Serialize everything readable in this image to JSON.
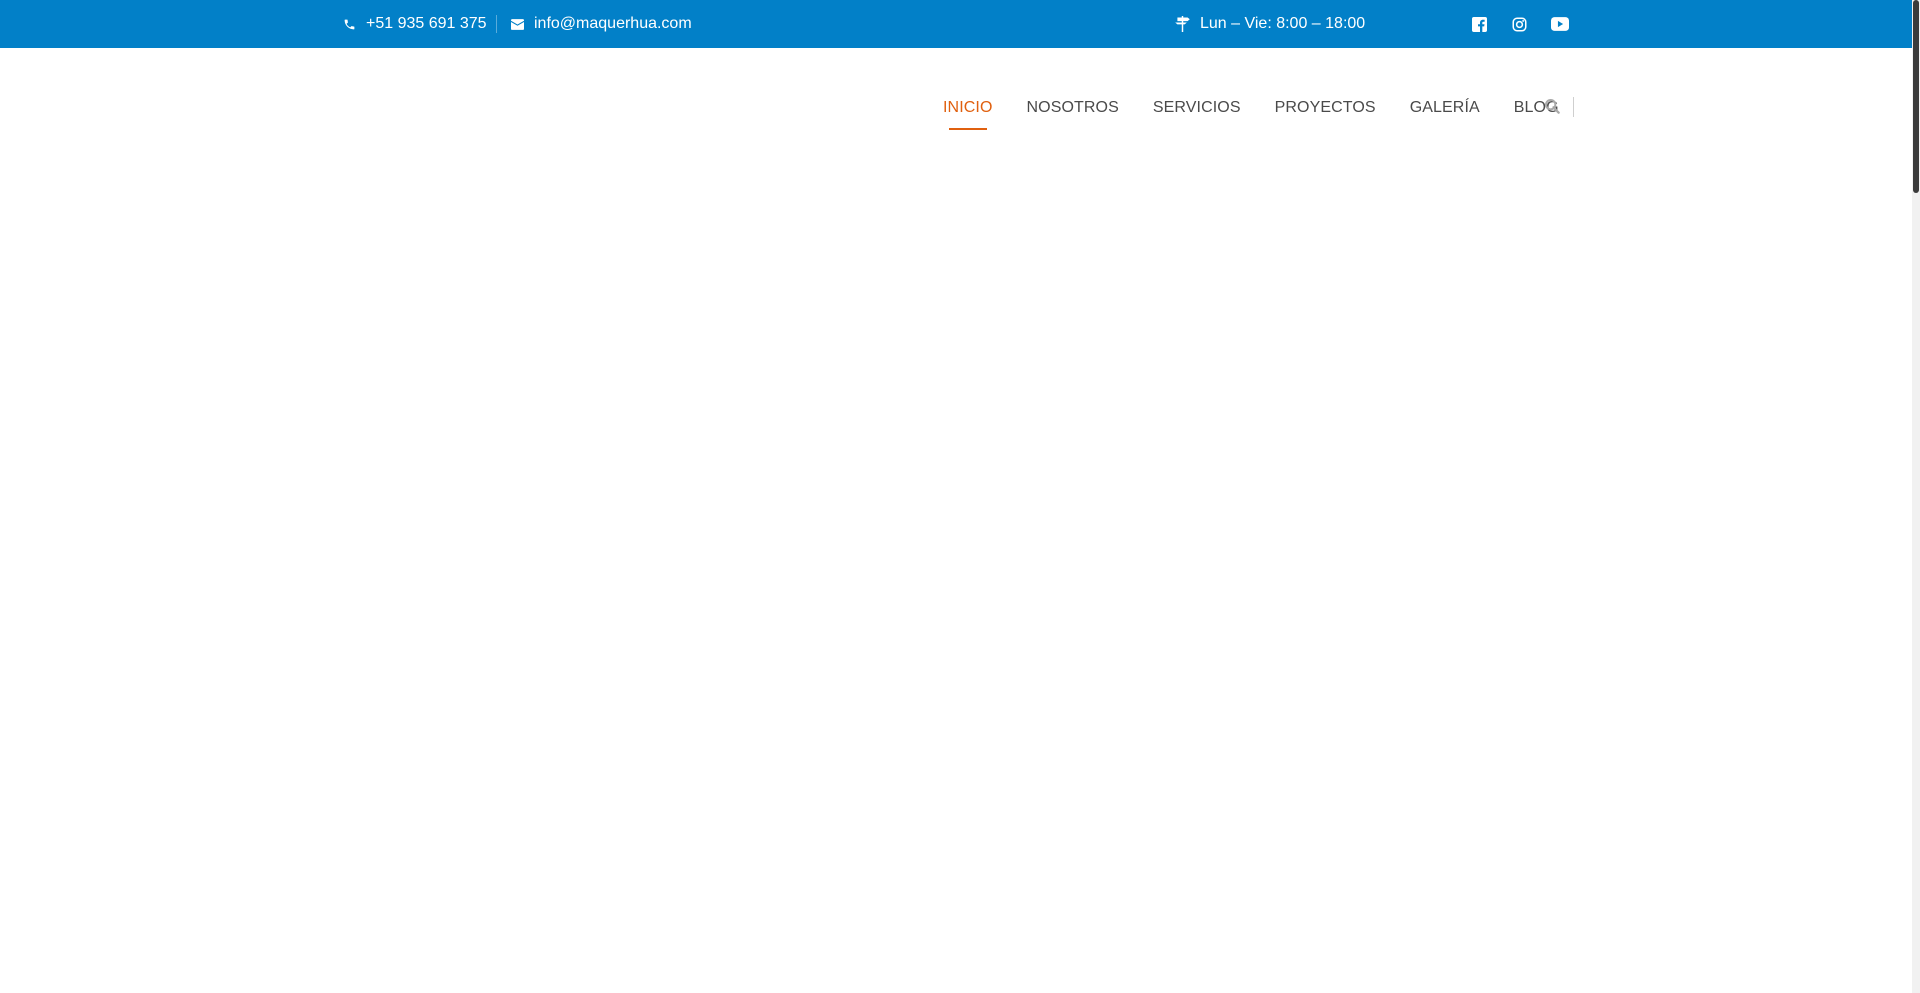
{
  "topbar": {
    "background": "#0280c8",
    "phone": {
      "icon": "phone-icon",
      "text": "+51 935 691 375"
    },
    "email": {
      "icon": "envelope-icon",
      "text": "info@maquerhua.com"
    },
    "hours": {
      "icon": "signpost-icon",
      "text": "Lun – Vie: 8:00 – 18:00"
    },
    "social": [
      {
        "name": "facebook",
        "icon": "facebook-icon"
      },
      {
        "name": "instagram",
        "icon": "instagram-icon"
      },
      {
        "name": "youtube",
        "icon": "youtube-icon"
      }
    ]
  },
  "nav": {
    "accent": "#e0600f",
    "items": [
      {
        "label": "INICIO",
        "active": true
      },
      {
        "label": "NOSOTROS",
        "active": false
      },
      {
        "label": "SERVICIOS",
        "active": false
      },
      {
        "label": "PROYECTOS",
        "active": false
      },
      {
        "label": "GALERÍA",
        "active": false
      },
      {
        "label": "BLOG",
        "active": false
      }
    ],
    "search_icon": "search-icon"
  }
}
